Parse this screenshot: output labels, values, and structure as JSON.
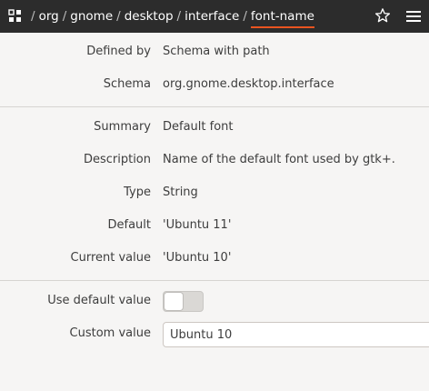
{
  "header": {
    "breadcrumb": [
      "org",
      "gnome",
      "desktop",
      "interface"
    ],
    "current": "font-name",
    "separator": "/",
    "icons": {
      "app": "tree-icon",
      "bookmark": "star-icon",
      "menu": "menu-icon"
    },
    "accent_color": "#e95420"
  },
  "details": {
    "defined_by": {
      "label": "Defined by",
      "value": "Schema with path"
    },
    "schema": {
      "label": "Schema",
      "value": "org.gnome.desktop.interface"
    },
    "summary": {
      "label": "Summary",
      "value": "Default font"
    },
    "description": {
      "label": "Description",
      "value": "Name of the default font used by gtk+."
    },
    "type": {
      "label": "Type",
      "value": "String"
    },
    "default": {
      "label": "Default",
      "value": "'Ubuntu 11'"
    },
    "current_value": {
      "label": "Current value",
      "value": "'Ubuntu 10'"
    }
  },
  "edit": {
    "use_default": {
      "label": "Use default value",
      "enabled": false
    },
    "custom_value": {
      "label": "Custom value",
      "value": "Ubuntu 10"
    }
  }
}
